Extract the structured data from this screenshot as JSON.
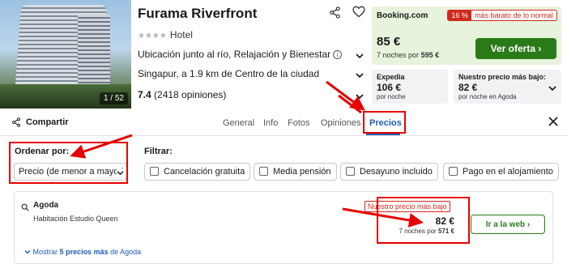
{
  "hotel": {
    "name": "Furama Riverfront",
    "type": "Hotel",
    "stars": "★★★★",
    "photo_counter": "1 / 52",
    "location_text": "Ubicación junto al río, Relajación y Bienestar",
    "distance_text": "Singapur, a 1.9 km de Centro de la ciudad",
    "rating": "7.4",
    "reviews": "(2418 opiniones)"
  },
  "main_deal": {
    "provider": "Booking.com",
    "discount_pct": "16 %",
    "discount_text": "más barato de lo normal",
    "price": "85 €",
    "nights_text": "7 noches por",
    "total": "595 €",
    "button_label": "Ver oferta ›"
  },
  "small_deals": [
    {
      "name": "Expedia",
      "price": "106 €",
      "sub": "por noche"
    },
    {
      "name": "Nuestro precio más bajo:",
      "price": "82 €",
      "sub": "por noche en Agoda"
    }
  ],
  "tabs": {
    "share_label": "Compartir",
    "items": [
      "General",
      "Info",
      "Fotos",
      "Opiniones",
      "Precios"
    ],
    "active": "Precios"
  },
  "filters": {
    "sort_label": "Ordenar por:",
    "sort_value": "Precio (de menor a mayor)",
    "filter_label": "Filtrar:",
    "options": [
      "Cancelación gratuita",
      "Media pensión",
      "Desayuno incluido",
      "Pago en el alojamiento"
    ]
  },
  "result": {
    "provider": "Agoda",
    "room": "Habitación Estudio Queen",
    "badge": "Nuestro precio más bajo",
    "price": "82 €",
    "nights_text": "7 noches por",
    "total": "571 €",
    "button_label": "Ir a la web ›",
    "more_prefix": "Mostrar",
    "more_count": "5 precios más",
    "more_suffix": "de Agoda"
  },
  "colors": {
    "accent": "#1f5cb4",
    "deal_green": "#2b7a19",
    "deal_bg": "#e7f3dc",
    "alert_red": "#d02a1c",
    "annotation_red": "#e60000"
  }
}
